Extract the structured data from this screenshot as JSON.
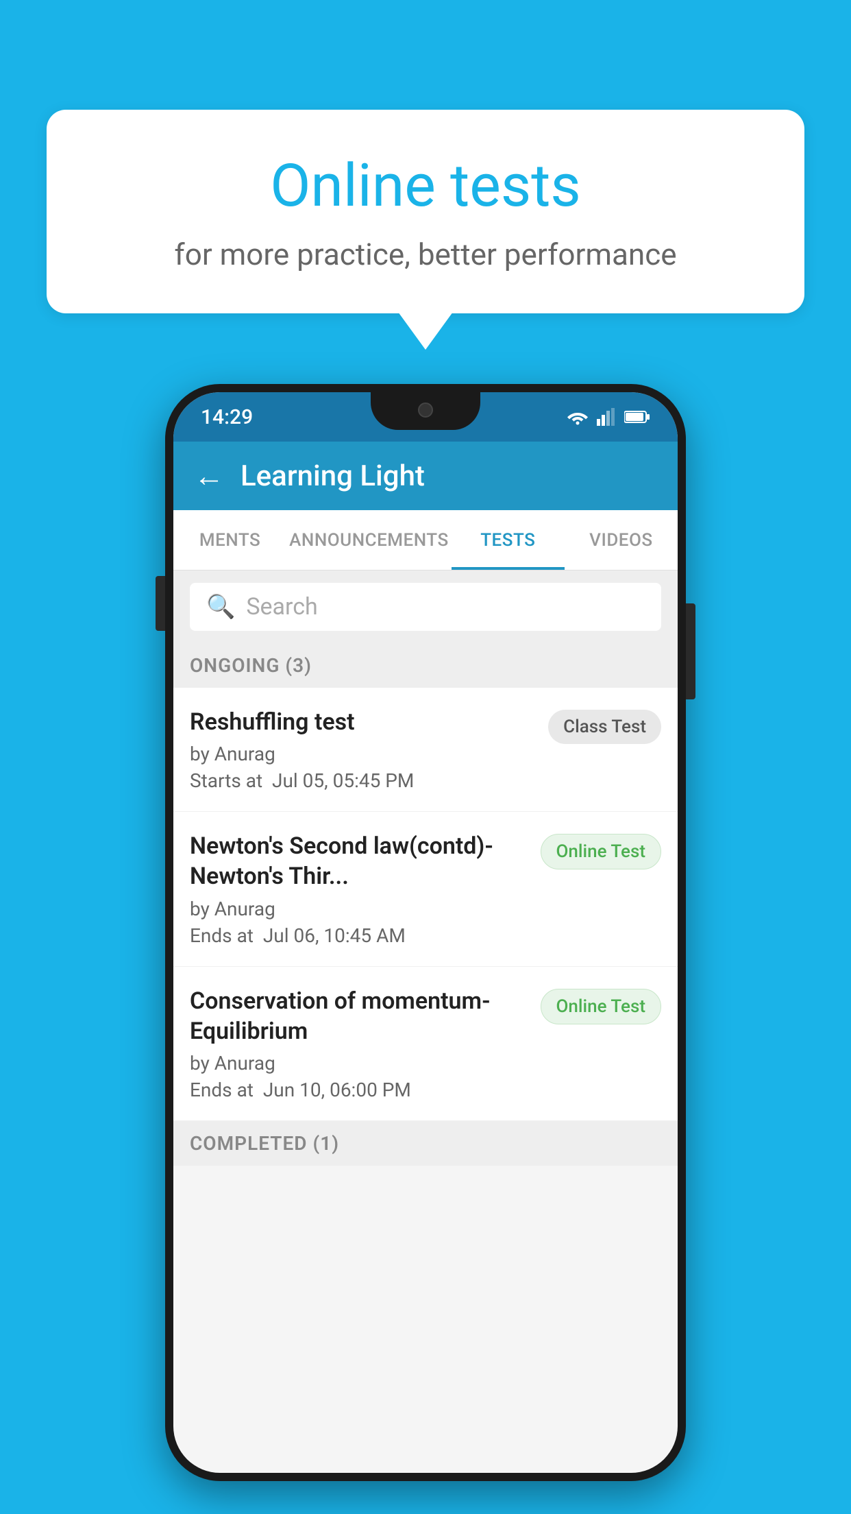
{
  "background_color": "#1ab3e8",
  "speech_bubble": {
    "title": "Online tests",
    "subtitle": "for more practice, better performance"
  },
  "phone": {
    "status_bar": {
      "time": "14:29"
    },
    "app_bar": {
      "back_label": "←",
      "title": "Learning Light"
    },
    "tabs": [
      {
        "label": "MENTS",
        "active": false
      },
      {
        "label": "ANNOUNCEMENTS",
        "active": false
      },
      {
        "label": "TESTS",
        "active": true
      },
      {
        "label": "VIDEOS",
        "active": false
      }
    ],
    "search": {
      "placeholder": "Search"
    },
    "ongoing_section": {
      "label": "ONGOING (3)"
    },
    "tests": [
      {
        "name": "Reshuffling test",
        "author": "by Anurag",
        "time_label": "Starts at",
        "time": "Jul 05, 05:45 PM",
        "badge": "Class Test",
        "badge_type": "class"
      },
      {
        "name": "Newton's Second law(contd)-Newton's Thir...",
        "author": "by Anurag",
        "time_label": "Ends at",
        "time": "Jul 06, 10:45 AM",
        "badge": "Online Test",
        "badge_type": "online"
      },
      {
        "name": "Conservation of momentum-Equilibrium",
        "author": "by Anurag",
        "time_label": "Ends at",
        "time": "Jun 10, 06:00 PM",
        "badge": "Online Test",
        "badge_type": "online"
      }
    ],
    "completed_section": {
      "label": "COMPLETED (1)"
    }
  }
}
